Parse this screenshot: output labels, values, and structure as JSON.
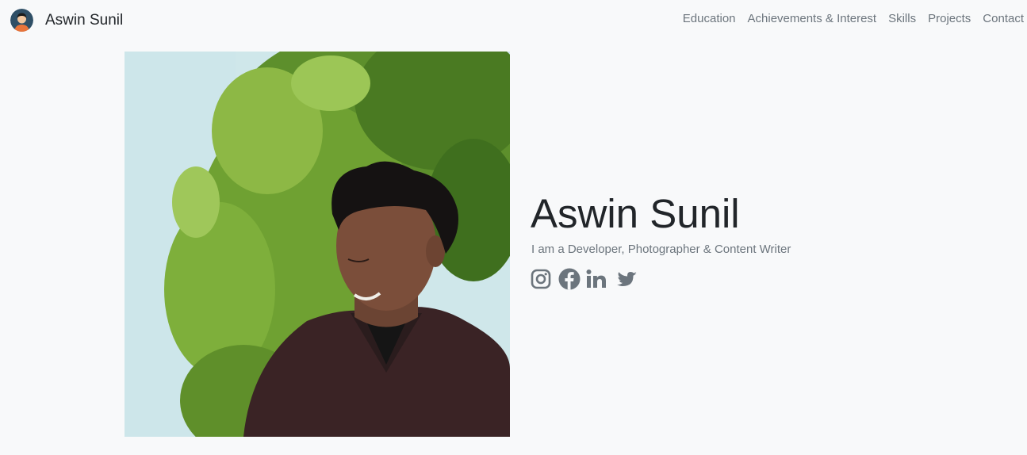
{
  "navbar": {
    "brand_name": "Aswin Sunil",
    "links": [
      "Education",
      "Achievements & Interest",
      "Skills",
      "Projects",
      "Contact"
    ]
  },
  "hero": {
    "title": "Aswin Sunil",
    "subtitle": "I am a Developer, Photographer & Content Writer",
    "socials": [
      "instagram-icon",
      "facebook-icon",
      "linkedin-icon",
      "twitter-icon"
    ]
  },
  "colors": {
    "background": "#f8f9fa",
    "text": "#212529",
    "muted": "#6c757d"
  }
}
